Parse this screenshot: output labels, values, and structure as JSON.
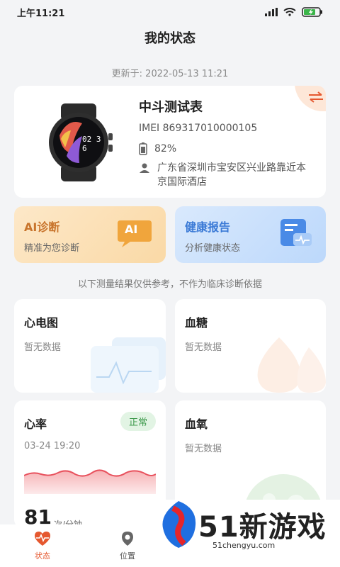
{
  "status_bar": {
    "time": "上午11:21",
    "battery_icon": "battery-charging-icon"
  },
  "header": {
    "title": "我的状态",
    "updated": "更新于: 2022-05-13 11:21"
  },
  "device": {
    "name": "中斗测试表",
    "imei": "IMEI 869317010000105",
    "battery": "82%",
    "address": "广东省深圳市宝安区兴业路靠近本京国际酒店",
    "watch_time": "02 36"
  },
  "features": [
    {
      "title": "AI诊断",
      "subtitle": "精准为您诊断",
      "icon_label": "AI"
    },
    {
      "title": "健康报告",
      "subtitle": "分析健康状态"
    }
  ],
  "disclaimer": "以下测量结果仅供参考，不作为临床诊断依据",
  "metrics": {
    "ecg": {
      "title": "心电图",
      "status": "暂无数据"
    },
    "glucose": {
      "title": "血糖",
      "status": "暂无数据"
    },
    "heart_rate": {
      "title": "心率",
      "badge": "正常",
      "time": "03-24 19:20",
      "value": "81",
      "unit": "次/分钟"
    },
    "oxygen": {
      "title": "血氧",
      "status": "暂无数据"
    }
  },
  "tabs": [
    {
      "label": "状态",
      "active": true
    },
    {
      "label": "位置",
      "active": false
    }
  ],
  "watermark": {
    "text": "51新游戏",
    "url": "51chengyu.com"
  },
  "colors": {
    "accent": "#e5582f",
    "ai_orange": "#c8742c",
    "report_blue": "#3b7ad6",
    "normal_green": "#3e9a4d"
  }
}
